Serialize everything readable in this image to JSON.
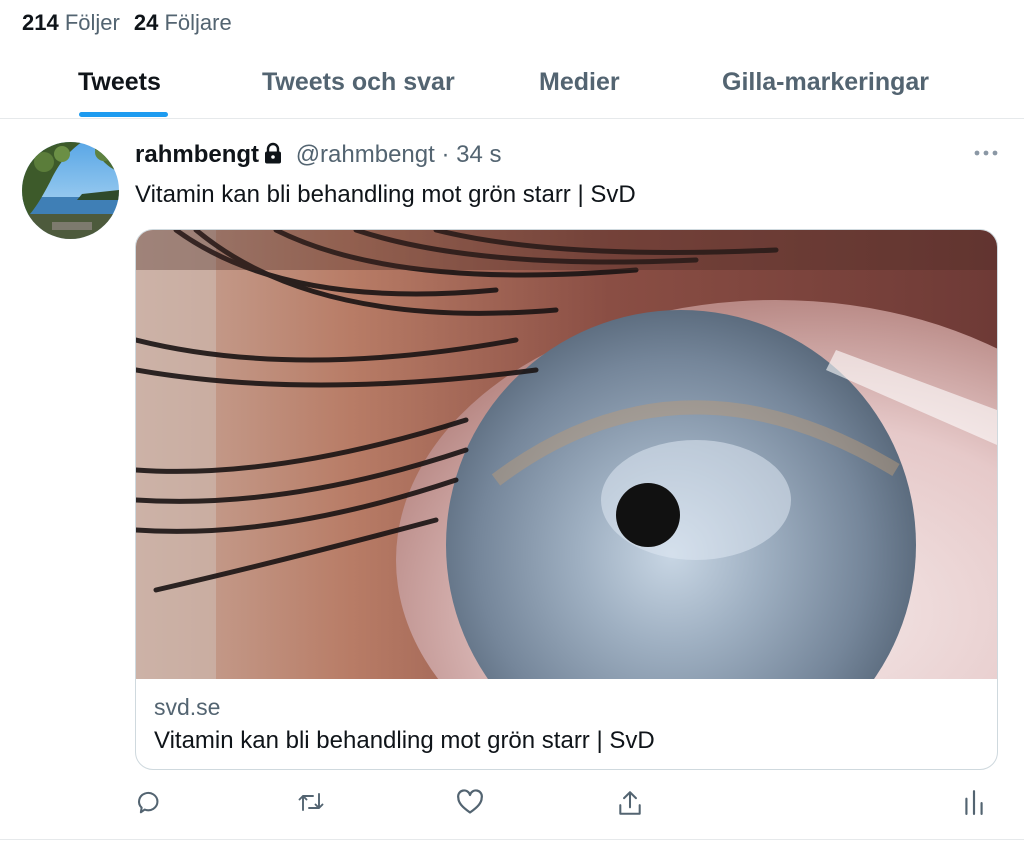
{
  "stats": {
    "following_count": "214",
    "following_label": "Följer",
    "followers_count": "24",
    "followers_label": "Följare"
  },
  "tabs": [
    {
      "label": "Tweets",
      "active": true
    },
    {
      "label": "Tweets och svar",
      "active": false
    },
    {
      "label": "Medier",
      "active": false
    },
    {
      "label": "Gilla-markeringar",
      "active": false
    }
  ],
  "tweet": {
    "display_name": "rahmbengt",
    "handle": "@rahmbengt",
    "separator": "·",
    "time": "34 s",
    "text": "Vitamin kan bli behandling mot grön starr | SvD",
    "card": {
      "domain": "svd.se",
      "title": "Vitamin kan bli behandling mot grön starr | SvD"
    },
    "icons": [
      "lock-icon",
      "more-icon",
      "reply-icon",
      "retweet-icon",
      "like-icon",
      "share-icon",
      "analytics-icon"
    ]
  },
  "colors": {
    "accent": "#1d9bf0",
    "text": "#0f1419",
    "secondary": "#536471",
    "border": "#cfd9de"
  }
}
